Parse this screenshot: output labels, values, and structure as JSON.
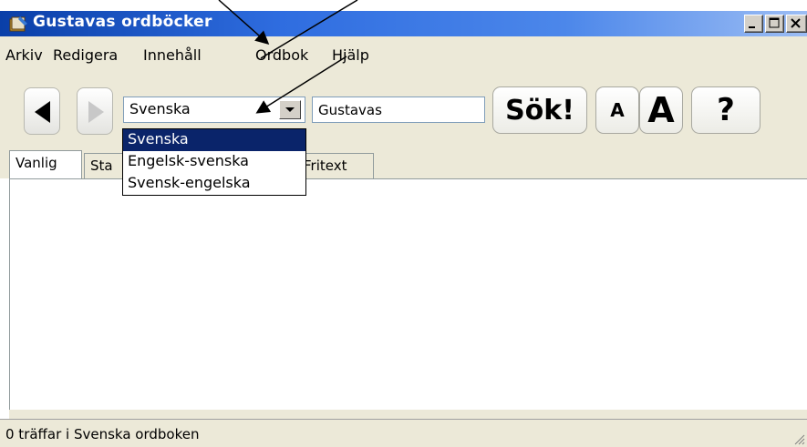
{
  "window": {
    "title": "Gustavas ordböcker"
  },
  "menu": [
    {
      "label": "Arkiv"
    },
    {
      "label": "Redigera"
    },
    {
      "label": "Innehåll"
    },
    {
      "label": "Ordbok"
    },
    {
      "label": "Hjälp"
    }
  ],
  "toolbar": {
    "dictionary_select": {
      "value": "Svenska"
    },
    "search": {
      "value": "Gustavas"
    },
    "search_button_label": "Sök!",
    "font_small_label": "A",
    "font_large_label": "A",
    "help_label": "?"
  },
  "dropdown": {
    "options": [
      "Svenska",
      "Engelsk-svenska",
      "Svensk-engelska"
    ],
    "selected_index": 0
  },
  "tabs": [
    {
      "label": "Vanlig",
      "active": true
    },
    {
      "label": "Sta"
    },
    {
      "label": "Fritext"
    }
  ],
  "status": {
    "text": "0 träffar i Svenska ordboken"
  },
  "colors": {
    "titlebar": "#2f6de0",
    "selection": "#0a246a",
    "chrome": "#ece9d8"
  }
}
